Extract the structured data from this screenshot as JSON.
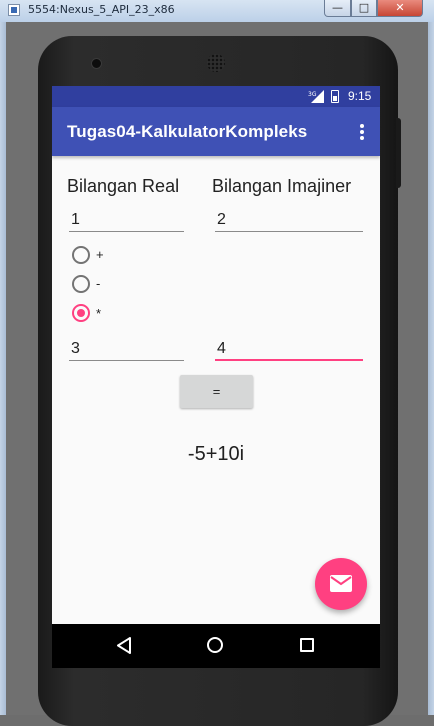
{
  "window": {
    "title": "5554:Nexus_5_API_23_x86",
    "min_glyph": "—",
    "max_glyph": "□",
    "close_glyph": "✕"
  },
  "statusbar": {
    "network": "3G",
    "time": "9:15"
  },
  "toolbar": {
    "title": "Tugas04-KalkulatorKompleks",
    "overflow_icon": "more-vert-icon"
  },
  "form": {
    "label_real": "Bilangan Real",
    "label_imag": "Bilangan Imajiner",
    "input1_real": "1",
    "input1_imag": "2",
    "operators": [
      {
        "label": "+",
        "checked": false
      },
      {
        "label": "-",
        "checked": false
      },
      {
        "label": "*",
        "checked": true
      }
    ],
    "input2_real": "3",
    "input2_imag": "4",
    "equals_label": "=",
    "result": "-5+10i"
  },
  "fab": {
    "icon": "email-icon"
  },
  "colors": {
    "primary": "#3f51b5",
    "primary_dark": "#303f9f",
    "accent": "#ff4081"
  },
  "navbar": {
    "back_icon": "back-icon",
    "home_icon": "home-icon",
    "recent_icon": "recent-apps-icon"
  }
}
